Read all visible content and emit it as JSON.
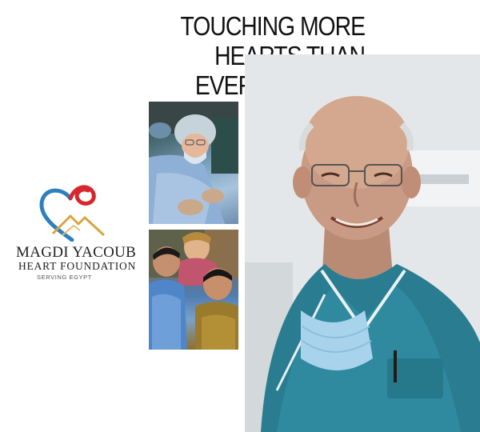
{
  "headline": {
    "line1": "TOUCHING MORE",
    "line2": "HEARTS THAN",
    "line3": "EVER IMAGINED"
  },
  "logo": {
    "title": "MAGDI YACOUB",
    "subtitle": "HEART FOUNDATION",
    "tagline": "SERVING EGYPT",
    "colors": {
      "heart_red": "#d7262d",
      "heart_blue": "#2e7fc0",
      "mountain_gold": "#d9a441"
    }
  },
  "photos": {
    "top": "surgeon-in-operating-room",
    "bottom": "children-with-nurse",
    "main": "smiling-doctor-in-scrubs"
  }
}
